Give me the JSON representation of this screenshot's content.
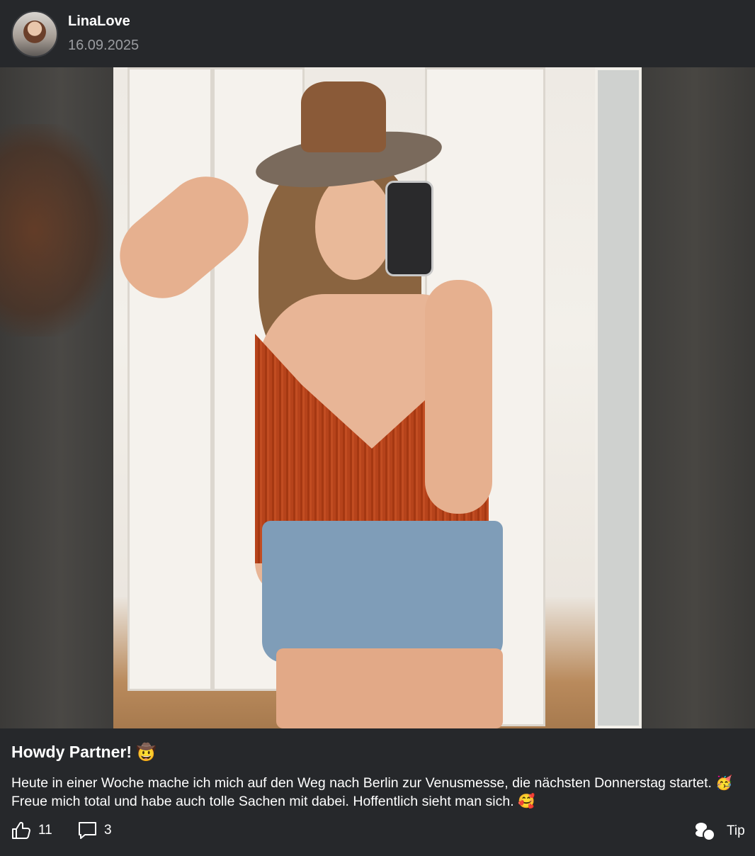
{
  "post": {
    "username": "LinaLove",
    "date": "16.09.2025",
    "title": "Howdy Partner! 🤠",
    "body": "Heute in einer Woche mache ich mich auf den Weg nach Berlin zur Venusmesse, die nächsten Donnerstag startet. 🥳 Freue mich total und habe auch tolle Sachen mit dabei. Hoffentlich sieht man sich. 🥰"
  },
  "actions": {
    "likes": "11",
    "comments": "3",
    "tip_label": "Tip"
  },
  "icons": {
    "like": "thumbs-up-icon",
    "comment": "comment-bubble-icon",
    "tip": "coins-icon"
  }
}
